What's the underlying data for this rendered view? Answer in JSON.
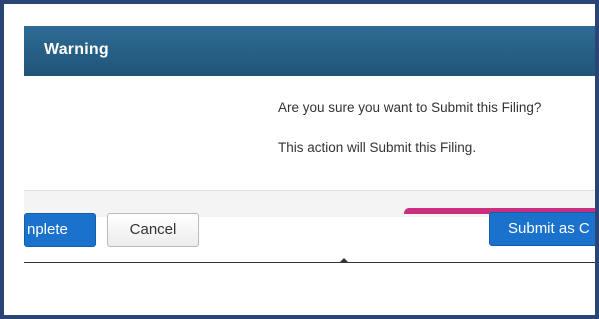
{
  "dialog": {
    "title": "Warning",
    "close_glyph": "›",
    "message_line1": "Are you sure you want to Submit this Filing?",
    "message_line2": "This action will Submit this Filing."
  },
  "buttons": {
    "complete_label": "nplete",
    "cancel_label": "Cancel",
    "submit_label": "Submit as C"
  },
  "colors": {
    "frame_border": "#2b4476",
    "title_bar": "#23607f",
    "primary_button": "#1a72cc",
    "accent_pink": "#cc2f7f"
  },
  "icons": {
    "close": "close-icon"
  }
}
